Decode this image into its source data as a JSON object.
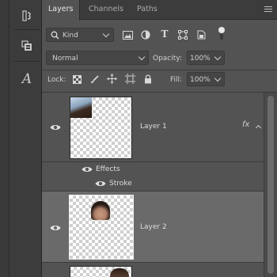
{
  "toolbar": {
    "tools": [
      {
        "icon": "adjust-panel-icon"
      },
      {
        "icon": "libraries-panel-icon"
      },
      {
        "icon": "character-panel-icon",
        "glyph": "A"
      }
    ]
  },
  "tabs": [
    {
      "label": "Layers",
      "active": true
    },
    {
      "label": "Channels",
      "active": false
    },
    {
      "label": "Paths",
      "active": false
    }
  ],
  "filter": {
    "kind_label": "Kind"
  },
  "blend": {
    "mode": "Normal",
    "opacity_label": "Opacity:",
    "opacity_value": "100%"
  },
  "lock": {
    "label": "Lock:",
    "fill_label": "Fill:",
    "fill_value": "100%"
  },
  "layers": [
    {
      "name": "Layer 1",
      "fx_label": "fx",
      "effects_label": "Effects",
      "stroke_label": "Stroke",
      "selected": false
    },
    {
      "name": "Layer 2",
      "selected": true
    },
    {
      "name": ""
    }
  ],
  "colors": {
    "panel": "#535353",
    "tabbar": "#3c3c3c",
    "selected_row": "#6a6a6a"
  }
}
